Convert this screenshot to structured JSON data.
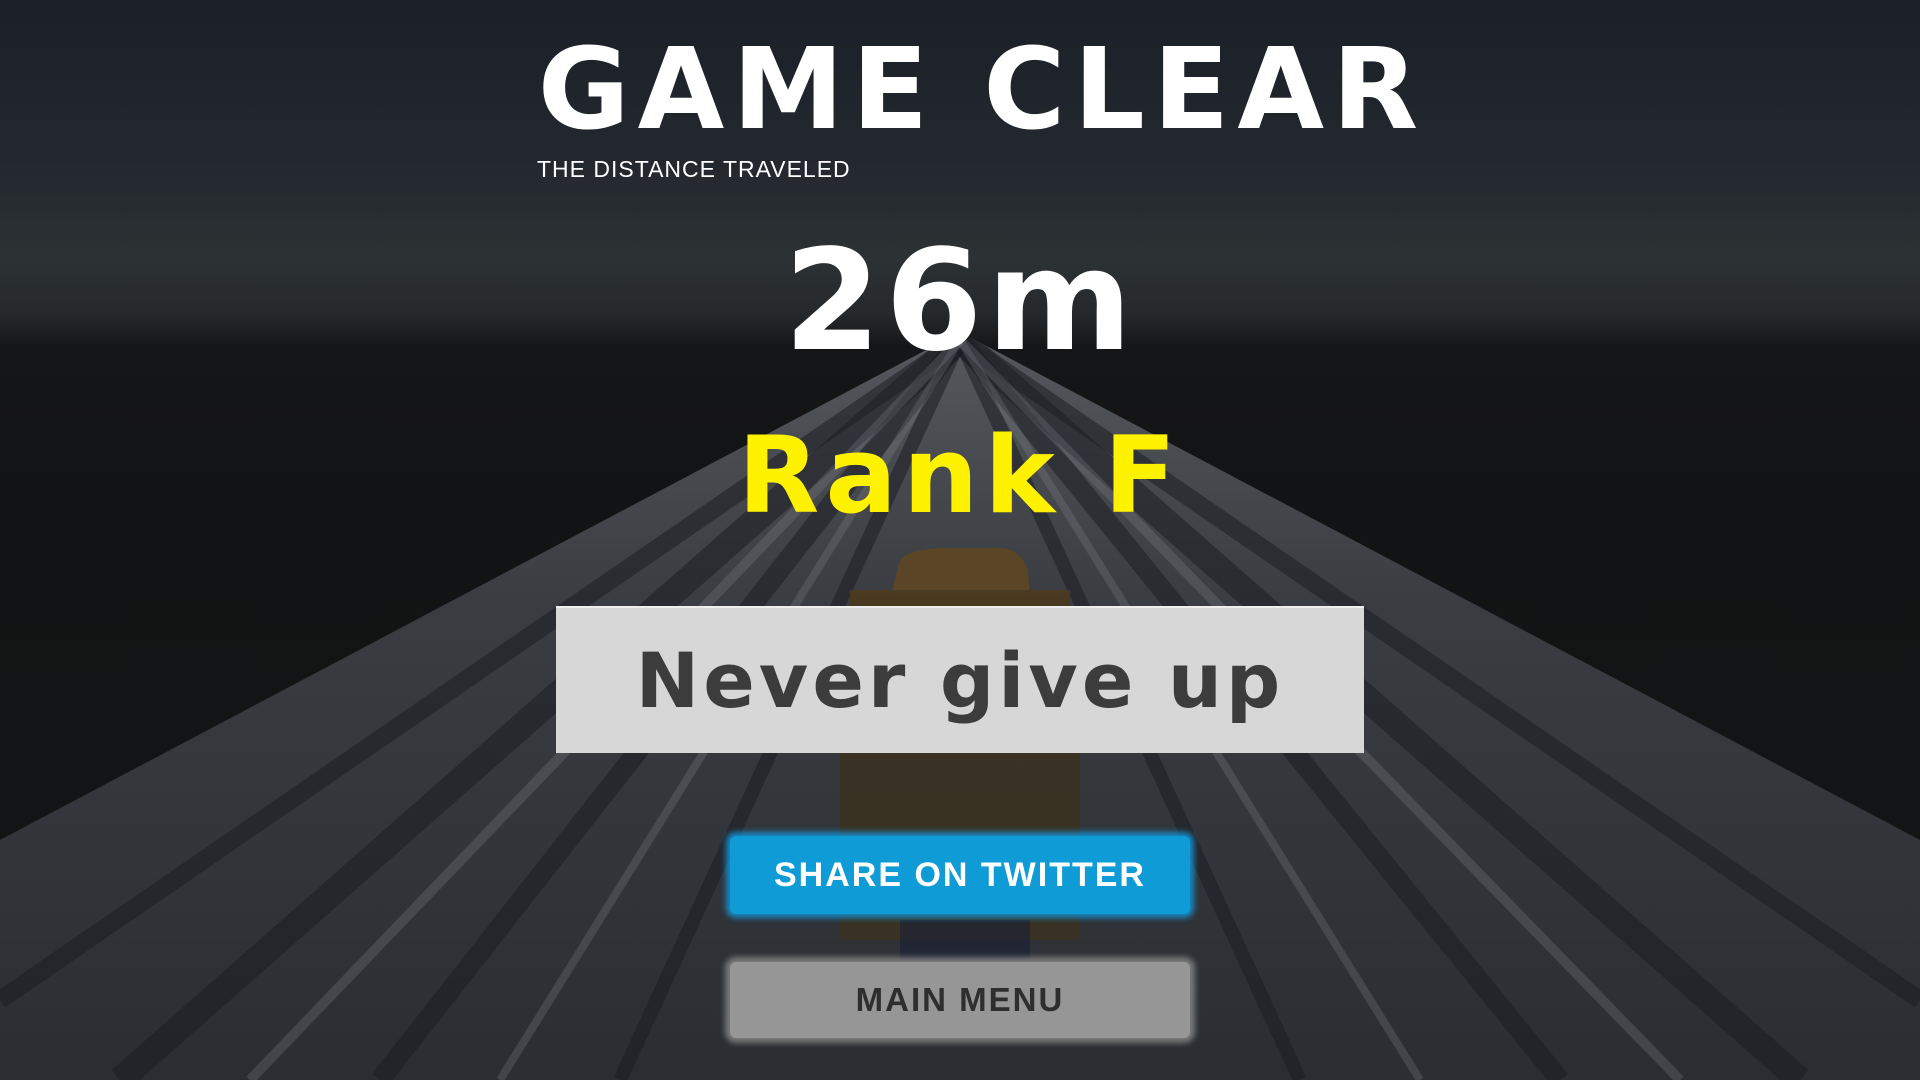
{
  "result": {
    "title": "GAME CLEAR",
    "subtitle": "THE DISTANCE TRAVELED",
    "distance": "26m",
    "rank": "Rank F",
    "message": "Never give up"
  },
  "buttons": {
    "share_label": "SHARE ON TWITTER",
    "menu_label": "MAIN MENU"
  },
  "colors": {
    "title": "#ffffff",
    "rank": "#fff200",
    "message_box": "#d7d7d7",
    "share_button": "#0f9bd6",
    "menu_button": "#969696"
  }
}
